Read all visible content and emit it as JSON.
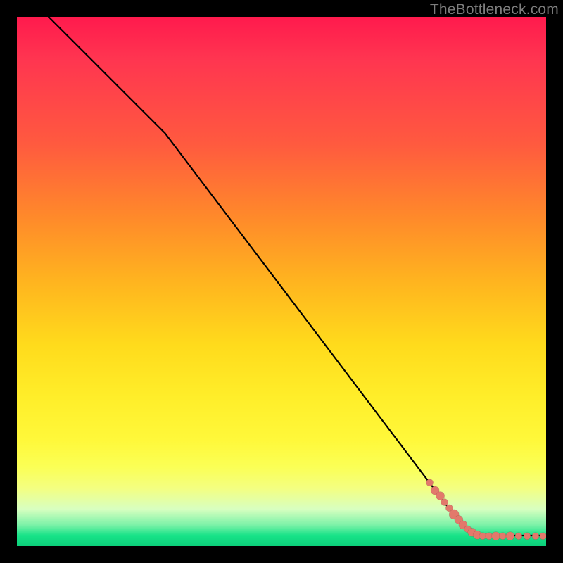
{
  "attribution": "TheBottleneck.com",
  "chart_data": {
    "type": "line",
    "title": "",
    "xlabel": "",
    "ylabel": "",
    "xlim": [
      0,
      100
    ],
    "ylim": [
      0,
      100
    ],
    "curve": [
      {
        "x": 6,
        "y": 100
      },
      {
        "x": 28,
        "y": 78
      },
      {
        "x": 84,
        "y": 4
      },
      {
        "x": 88,
        "y": 2
      },
      {
        "x": 100,
        "y": 2
      }
    ],
    "points": [
      {
        "x": 78,
        "y": 12,
        "r": 5
      },
      {
        "x": 79,
        "y": 10.5,
        "r": 6
      },
      {
        "x": 80,
        "y": 9.5,
        "r": 6
      },
      {
        "x": 80.8,
        "y": 8.3,
        "r": 5
      },
      {
        "x": 81.7,
        "y": 7.2,
        "r": 5
      },
      {
        "x": 82.6,
        "y": 6.0,
        "r": 7
      },
      {
        "x": 83.5,
        "y": 5.0,
        "r": 6
      },
      {
        "x": 84.3,
        "y": 4.0,
        "r": 6
      },
      {
        "x": 85.2,
        "y": 3.2,
        "r": 5
      },
      {
        "x": 86.0,
        "y": 2.6,
        "r": 6
      },
      {
        "x": 87.0,
        "y": 2.1,
        "r": 6
      },
      {
        "x": 88.0,
        "y": 1.9,
        "r": 5
      },
      {
        "x": 89.2,
        "y": 1.9,
        "r": 5
      },
      {
        "x": 90.5,
        "y": 1.9,
        "r": 6
      },
      {
        "x": 91.8,
        "y": 1.9,
        "r": 5
      },
      {
        "x": 93.2,
        "y": 1.9,
        "r": 6
      },
      {
        "x": 94.8,
        "y": 1.9,
        "r": 5
      },
      {
        "x": 96.4,
        "y": 1.9,
        "r": 5
      },
      {
        "x": 98.0,
        "y": 1.9,
        "r": 5
      },
      {
        "x": 99.4,
        "y": 1.9,
        "r": 5
      }
    ],
    "background_gradient": {
      "top": "#ff1a4d",
      "mid": "#ffdb1c",
      "bottom": "#0ccf7a"
    }
  }
}
